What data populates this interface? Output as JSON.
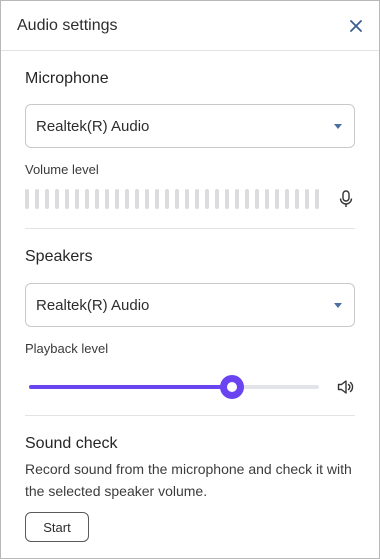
{
  "header": {
    "title": "Audio settings"
  },
  "microphone": {
    "section_title": "Microphone",
    "selected_device": "Realtek(R) Audio",
    "volume_label": "Volume level",
    "meter_level": 0
  },
  "speakers": {
    "section_title": "Speakers",
    "selected_device": "Realtek(R) Audio",
    "playback_label": "Playback level",
    "playback_value": 0.7
  },
  "sound_check": {
    "section_title": "Sound check",
    "description": "Record sound from the microphone and check it with the selected speaker volume.",
    "start_label": "Start"
  },
  "colors": {
    "accent": "#6a44f0"
  },
  "icons": {
    "close": "close-icon",
    "mic": "microphone-icon",
    "speaker": "speaker-icon",
    "dropdown": "chevron-down-icon"
  }
}
